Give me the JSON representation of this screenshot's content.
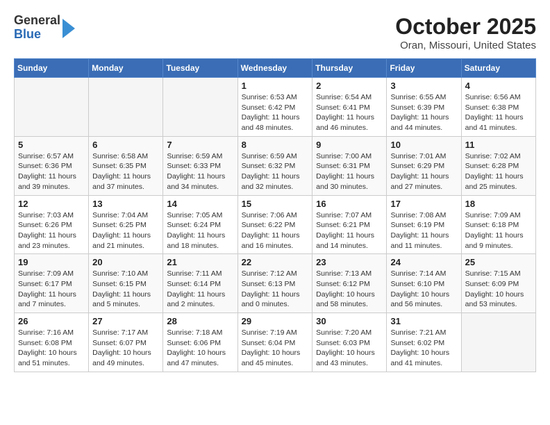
{
  "logo": {
    "general": "General",
    "blue": "Blue"
  },
  "title": "October 2025",
  "subtitle": "Oran, Missouri, United States",
  "days_of_week": [
    "Sunday",
    "Monday",
    "Tuesday",
    "Wednesday",
    "Thursday",
    "Friday",
    "Saturday"
  ],
  "weeks": [
    [
      {
        "day": "",
        "info": ""
      },
      {
        "day": "",
        "info": ""
      },
      {
        "day": "",
        "info": ""
      },
      {
        "day": "1",
        "info": "Sunrise: 6:53 AM\nSunset: 6:42 PM\nDaylight: 11 hours and 48 minutes."
      },
      {
        "day": "2",
        "info": "Sunrise: 6:54 AM\nSunset: 6:41 PM\nDaylight: 11 hours and 46 minutes."
      },
      {
        "day": "3",
        "info": "Sunrise: 6:55 AM\nSunset: 6:39 PM\nDaylight: 11 hours and 44 minutes."
      },
      {
        "day": "4",
        "info": "Sunrise: 6:56 AM\nSunset: 6:38 PM\nDaylight: 11 hours and 41 minutes."
      }
    ],
    [
      {
        "day": "5",
        "info": "Sunrise: 6:57 AM\nSunset: 6:36 PM\nDaylight: 11 hours and 39 minutes."
      },
      {
        "day": "6",
        "info": "Sunrise: 6:58 AM\nSunset: 6:35 PM\nDaylight: 11 hours and 37 minutes."
      },
      {
        "day": "7",
        "info": "Sunrise: 6:59 AM\nSunset: 6:33 PM\nDaylight: 11 hours and 34 minutes."
      },
      {
        "day": "8",
        "info": "Sunrise: 6:59 AM\nSunset: 6:32 PM\nDaylight: 11 hours and 32 minutes."
      },
      {
        "day": "9",
        "info": "Sunrise: 7:00 AM\nSunset: 6:31 PM\nDaylight: 11 hours and 30 minutes."
      },
      {
        "day": "10",
        "info": "Sunrise: 7:01 AM\nSunset: 6:29 PM\nDaylight: 11 hours and 27 minutes."
      },
      {
        "day": "11",
        "info": "Sunrise: 7:02 AM\nSunset: 6:28 PM\nDaylight: 11 hours and 25 minutes."
      }
    ],
    [
      {
        "day": "12",
        "info": "Sunrise: 7:03 AM\nSunset: 6:26 PM\nDaylight: 11 hours and 23 minutes."
      },
      {
        "day": "13",
        "info": "Sunrise: 7:04 AM\nSunset: 6:25 PM\nDaylight: 11 hours and 21 minutes."
      },
      {
        "day": "14",
        "info": "Sunrise: 7:05 AM\nSunset: 6:24 PM\nDaylight: 11 hours and 18 minutes."
      },
      {
        "day": "15",
        "info": "Sunrise: 7:06 AM\nSunset: 6:22 PM\nDaylight: 11 hours and 16 minutes."
      },
      {
        "day": "16",
        "info": "Sunrise: 7:07 AM\nSunset: 6:21 PM\nDaylight: 11 hours and 14 minutes."
      },
      {
        "day": "17",
        "info": "Sunrise: 7:08 AM\nSunset: 6:19 PM\nDaylight: 11 hours and 11 minutes."
      },
      {
        "day": "18",
        "info": "Sunrise: 7:09 AM\nSunset: 6:18 PM\nDaylight: 11 hours and 9 minutes."
      }
    ],
    [
      {
        "day": "19",
        "info": "Sunrise: 7:09 AM\nSunset: 6:17 PM\nDaylight: 11 hours and 7 minutes."
      },
      {
        "day": "20",
        "info": "Sunrise: 7:10 AM\nSunset: 6:15 PM\nDaylight: 11 hours and 5 minutes."
      },
      {
        "day": "21",
        "info": "Sunrise: 7:11 AM\nSunset: 6:14 PM\nDaylight: 11 hours and 2 minutes."
      },
      {
        "day": "22",
        "info": "Sunrise: 7:12 AM\nSunset: 6:13 PM\nDaylight: 11 hours and 0 minutes."
      },
      {
        "day": "23",
        "info": "Sunrise: 7:13 AM\nSunset: 6:12 PM\nDaylight: 10 hours and 58 minutes."
      },
      {
        "day": "24",
        "info": "Sunrise: 7:14 AM\nSunset: 6:10 PM\nDaylight: 10 hours and 56 minutes."
      },
      {
        "day": "25",
        "info": "Sunrise: 7:15 AM\nSunset: 6:09 PM\nDaylight: 10 hours and 53 minutes."
      }
    ],
    [
      {
        "day": "26",
        "info": "Sunrise: 7:16 AM\nSunset: 6:08 PM\nDaylight: 10 hours and 51 minutes."
      },
      {
        "day": "27",
        "info": "Sunrise: 7:17 AM\nSunset: 6:07 PM\nDaylight: 10 hours and 49 minutes."
      },
      {
        "day": "28",
        "info": "Sunrise: 7:18 AM\nSunset: 6:06 PM\nDaylight: 10 hours and 47 minutes."
      },
      {
        "day": "29",
        "info": "Sunrise: 7:19 AM\nSunset: 6:04 PM\nDaylight: 10 hours and 45 minutes."
      },
      {
        "day": "30",
        "info": "Sunrise: 7:20 AM\nSunset: 6:03 PM\nDaylight: 10 hours and 43 minutes."
      },
      {
        "day": "31",
        "info": "Sunrise: 7:21 AM\nSunset: 6:02 PM\nDaylight: 10 hours and 41 minutes."
      },
      {
        "day": "",
        "info": ""
      }
    ]
  ]
}
